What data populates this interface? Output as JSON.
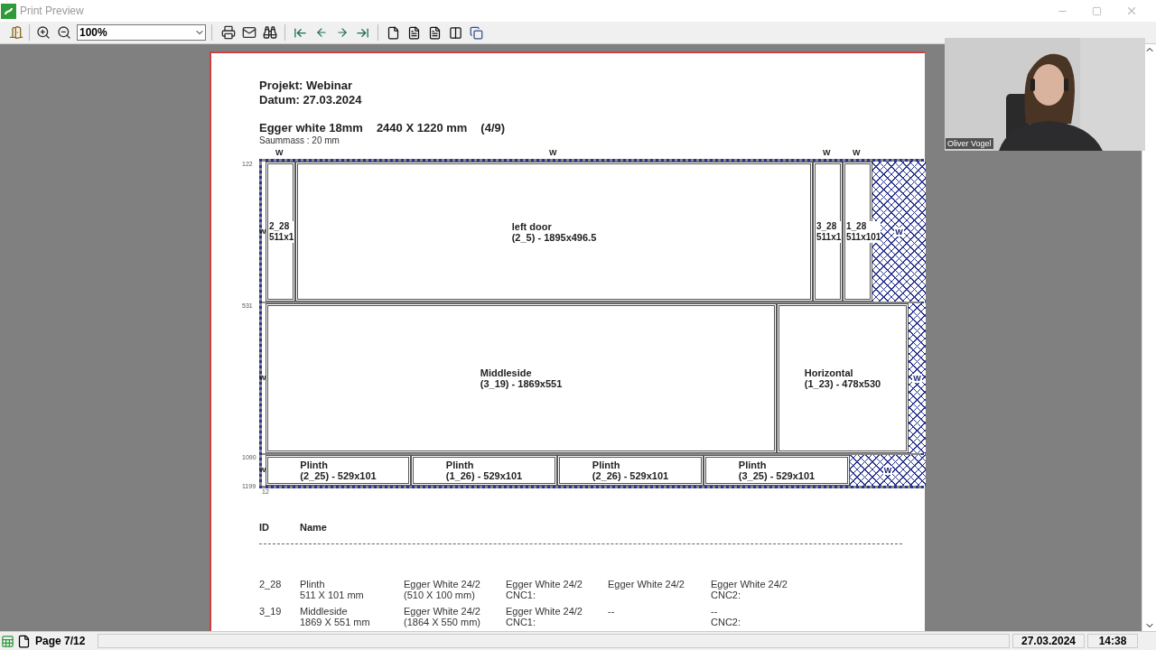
{
  "window": {
    "title": "Print Preview"
  },
  "toolbar": {
    "zoom": "100%"
  },
  "page": {
    "project": "Projekt: Webinar",
    "date": "Datum: 27.03.2024",
    "material": "Egger white 18mm",
    "sheet_size": "2440 X 1220 mm",
    "sheet_count": "(4/9)",
    "margin": "Saummass : 20 mm",
    "diagram": {
      "top_markers": [
        "W",
        "W",
        "W",
        "W"
      ],
      "rows": [
        {
          "ruler": "122",
          "edge_marker": "W",
          "pieces": [
            {
              "kind": "part",
              "lines": [
                "2_28",
                "511x1"
              ]
            },
            {
              "kind": "part",
              "lines": [
                "left door",
                "(2_5) - 1895x496.5"
              ]
            },
            {
              "kind": "part",
              "lines": [
                "3_28",
                "511x1"
              ]
            },
            {
              "kind": "part",
              "lines": [
                "1_28",
                "511x101"
              ]
            },
            {
              "kind": "waste",
              "lines": [
                "W"
              ]
            }
          ]
        },
        {
          "ruler": "531",
          "edge_marker": "W",
          "pieces": [
            {
              "kind": "part",
              "lines": [
                "Middleside",
                "(3_19) - 1869x551"
              ]
            },
            {
              "kind": "part",
              "lines": [
                "Horizontal",
                "(1_23) - 478x530"
              ]
            },
            {
              "kind": "waste",
              "lines": [
                "W"
              ]
            }
          ]
        },
        {
          "ruler": "1090",
          "edge_marker": "W",
          "pieces": [
            {
              "kind": "part",
              "lines": [
                "Plinth",
                "(2_25) - 529x101"
              ]
            },
            {
              "kind": "part",
              "lines": [
                "Plinth",
                "(1_26) - 529x101"
              ]
            },
            {
              "kind": "part",
              "lines": [
                "Plinth",
                "(2_26) - 529x101"
              ]
            },
            {
              "kind": "part",
              "lines": [
                "Plinth",
                "(3_25) - 529x101"
              ]
            },
            {
              "kind": "waste",
              "lines": [
                "W"
              ]
            }
          ]
        }
      ],
      "bottom_ruler": "1199",
      "bottom_marker": "12"
    },
    "table": {
      "header": {
        "id": "ID",
        "name": "Name"
      },
      "rows": [
        {
          "id": "2_28",
          "cells": [
            [
              "Plinth",
              "511 X 101 mm"
            ],
            [
              "Egger White 24/2",
              "(510 X 100 mm)"
            ],
            [
              "Egger White 24/2",
              "CNC1:"
            ],
            [
              "Egger White 24/2"
            ],
            [
              "Egger White 24/2",
              "CNC2:"
            ]
          ]
        },
        {
          "id": "3_19",
          "cells": [
            [
              "Middleside",
              "1869 X 551 mm"
            ],
            [
              "Egger White 24/2",
              "(1864 X 550 mm)"
            ],
            [
              "Egger White 24/2",
              "CNC1:"
            ],
            [
              "--"
            ],
            [
              "--",
              "CNC2:"
            ]
          ]
        }
      ]
    }
  },
  "video_overlay": {
    "name": "Oliver Vogel"
  },
  "status_bar": {
    "page": "Page 7/12",
    "date": "27.03.2024",
    "time": "14:38"
  }
}
